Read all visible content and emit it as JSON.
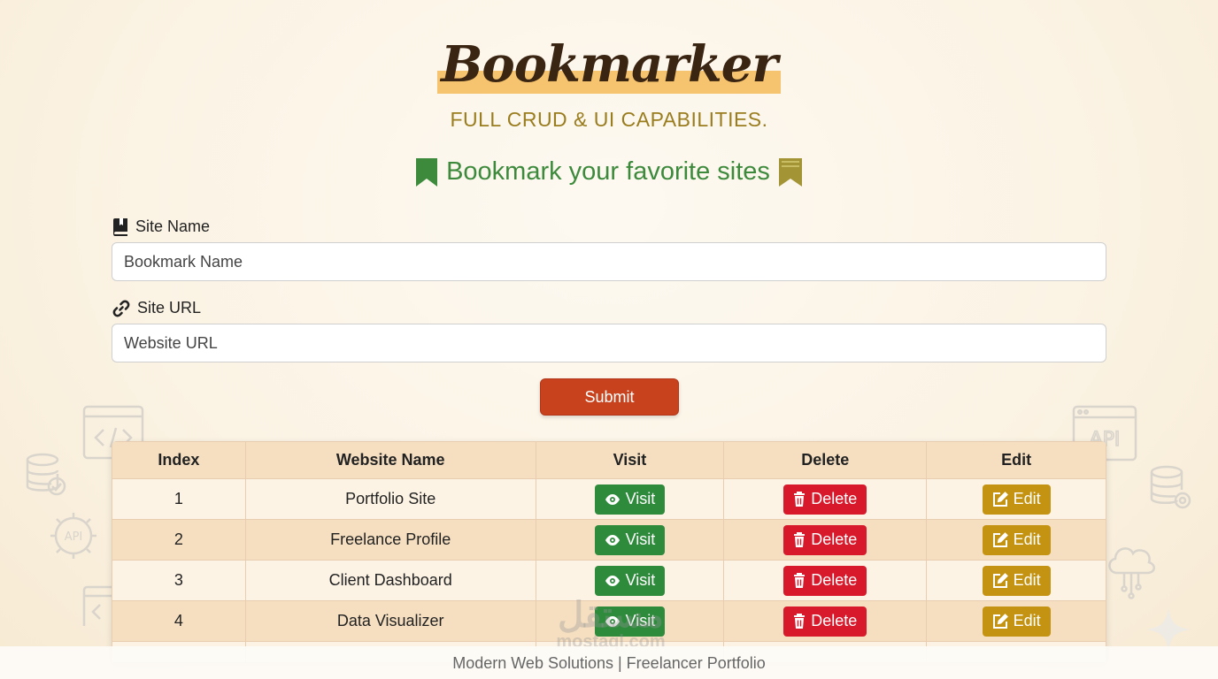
{
  "app": {
    "logo": "Bookmarker",
    "subtitle": "FULL CRUD & UI CAPABILITIES.",
    "heading": "Bookmark your favorite sites"
  },
  "form": {
    "site_name_label": "Site Name",
    "site_name_value": "Bookmark Name",
    "site_url_label": "Site URL",
    "site_url_value": "Website URL",
    "submit_label": "Submit"
  },
  "table": {
    "headers": [
      "Index",
      "Website Name",
      "Visit",
      "Delete",
      "Edit"
    ],
    "rows": [
      {
        "index": "1",
        "name": "Portfolio Site"
      },
      {
        "index": "2",
        "name": "Freelance Profile"
      },
      {
        "index": "3",
        "name": "Client Dashboard"
      },
      {
        "index": "4",
        "name": "Data Visualizer"
      }
    ],
    "visit_label": "Visit",
    "delete_label": "Delete",
    "edit_label": "Edit"
  },
  "icons": {
    "heading_left": "bookmark-icon",
    "heading_right": "bookmark-ribbon-icon",
    "site_name": "book-icon",
    "site_url": "link-icon",
    "visit": "eye-icon",
    "delete": "trash-icon",
    "edit": "edit-icon"
  },
  "colors": {
    "submit": "#c8421d",
    "visit": "#2e8b3c",
    "delete": "#d7192b",
    "edit": "#c59312",
    "heading": "#3d8a3c",
    "subtitle": "#9a7d1e"
  },
  "watermark": {
    "line1": "مستقل",
    "line2": "mostaql.com"
  },
  "footer": "Modern Web Solutions | Freelancer Portfolio"
}
